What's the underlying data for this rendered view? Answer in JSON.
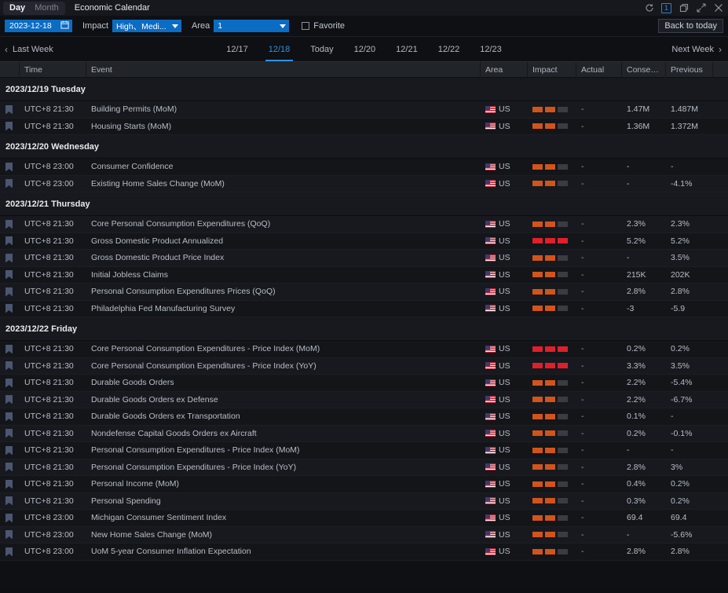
{
  "titlebar": {
    "modes": [
      {
        "label": "Day",
        "active": true
      },
      {
        "label": "Month",
        "active": false
      }
    ],
    "app_title": "Economic Calendar",
    "window_controls": [
      {
        "name": "refresh-icon",
        "label": "↻"
      },
      {
        "name": "window-count-badge",
        "label": "1"
      },
      {
        "name": "restore-icon",
        "label": "❐"
      },
      {
        "name": "expand-icon",
        "label": "⤢"
      },
      {
        "name": "close-icon",
        "label": "✕"
      }
    ]
  },
  "filters": {
    "date_value": "2023-12-18",
    "calendar_icon": "calendar-icon",
    "impact_label": "Impact",
    "impact_value": "High、Medi...",
    "area_label": "Area",
    "area_value": "1",
    "favorite_label": "Favorite",
    "favorite_checked": false,
    "back_to_today": "Back to today"
  },
  "datenav": {
    "prev_label": "Last Week",
    "next_label": "Next Week",
    "tabs": [
      {
        "label": "12/17",
        "active": false
      },
      {
        "label": "12/18",
        "active": true
      },
      {
        "label": "Today",
        "active": false
      },
      {
        "label": "12/20",
        "active": false
      },
      {
        "label": "12/21",
        "active": false
      },
      {
        "label": "12/22",
        "active": false
      },
      {
        "label": "12/23",
        "active": false
      }
    ]
  },
  "table": {
    "headers": {
      "bookmark": "",
      "time": "Time",
      "event": "Event",
      "area": "Area",
      "impact": "Impact",
      "actual": "Actual",
      "consensus": "Consensus",
      "previous": "Previous"
    },
    "groups": [
      {
        "date_label": "2023/12/19 Tuesday",
        "rows": [
          {
            "time": "UTC+8 21:30",
            "event": "Building Permits (MoM)",
            "area": "US",
            "impact": 2,
            "actual": "-",
            "consensus": "1.47M",
            "previous": "1.487M"
          },
          {
            "time": "UTC+8 21:30",
            "event": "Housing Starts (MoM)",
            "area": "US",
            "impact": 2,
            "actual": "-",
            "consensus": "1.36M",
            "previous": "1.372M"
          }
        ]
      },
      {
        "date_label": "2023/12/20 Wednesday",
        "rows": [
          {
            "time": "UTC+8 23:00",
            "event": "Consumer Confidence",
            "area": "US",
            "impact": 2,
            "actual": "-",
            "consensus": "-",
            "previous": "-"
          },
          {
            "time": "UTC+8 23:00",
            "event": "Existing Home Sales Change (MoM)",
            "area": "US",
            "impact": 2,
            "actual": "-",
            "consensus": "-",
            "previous": "-4.1%"
          }
        ]
      },
      {
        "date_label": "2023/12/21 Thursday",
        "rows": [
          {
            "time": "UTC+8 21:30",
            "event": "Core Personal Consumption Expenditures (QoQ)",
            "area": "US",
            "impact": 2,
            "actual": "-",
            "consensus": "2.3%",
            "previous": "2.3%"
          },
          {
            "time": "UTC+8 21:30",
            "event": "Gross Domestic Product Annualized",
            "area": "US",
            "impact": 3,
            "actual": "-",
            "consensus": "5.2%",
            "previous": "5.2%"
          },
          {
            "time": "UTC+8 21:30",
            "event": "Gross Domestic Product Price Index",
            "area": "US",
            "impact": 2,
            "actual": "-",
            "consensus": "-",
            "previous": "3.5%"
          },
          {
            "time": "UTC+8 21:30",
            "event": "Initial Jobless Claims",
            "area": "US",
            "impact": 2,
            "actual": "-",
            "consensus": "215K",
            "previous": "202K"
          },
          {
            "time": "UTC+8 21:30",
            "event": "Personal Consumption Expenditures Prices (QoQ)",
            "area": "US",
            "impact": 2,
            "actual": "-",
            "consensus": "2.8%",
            "previous": "2.8%"
          },
          {
            "time": "UTC+8 21:30",
            "event": "Philadelphia Fed Manufacturing Survey",
            "area": "US",
            "impact": 2,
            "actual": "-",
            "consensus": "-3",
            "previous": "-5.9"
          }
        ]
      },
      {
        "date_label": "2023/12/22 Friday",
        "rows": [
          {
            "time": "UTC+8 21:30",
            "event": "Core Personal Consumption Expenditures - Price Index (MoM)",
            "area": "US",
            "impact": 3,
            "actual": "-",
            "consensus": "0.2%",
            "previous": "0.2%"
          },
          {
            "time": "UTC+8 21:30",
            "event": "Core Personal Consumption Expenditures - Price Index (YoY)",
            "area": "US",
            "impact": 3,
            "actual": "-",
            "consensus": "3.3%",
            "previous": "3.5%"
          },
          {
            "time": "UTC+8 21:30",
            "event": "Durable Goods Orders",
            "area": "US",
            "impact": 2,
            "actual": "-",
            "consensus": "2.2%",
            "previous": "-5.4%"
          },
          {
            "time": "UTC+8 21:30",
            "event": "Durable Goods Orders ex Defense",
            "area": "US",
            "impact": 2,
            "actual": "-",
            "consensus": "2.2%",
            "previous": "-6.7%"
          },
          {
            "time": "UTC+8 21:30",
            "event": "Durable Goods Orders ex Transportation",
            "area": "US",
            "impact": 2,
            "actual": "-",
            "consensus": "0.1%",
            "previous": "-"
          },
          {
            "time": "UTC+8 21:30",
            "event": "Nondefense Capital Goods Orders ex Aircraft",
            "area": "US",
            "impact": 2,
            "actual": "-",
            "consensus": "0.2%",
            "previous": "-0.1%"
          },
          {
            "time": "UTC+8 21:30",
            "event": "Personal Consumption Expenditures - Price Index (MoM)",
            "area": "US",
            "impact": 2,
            "actual": "-",
            "consensus": "-",
            "previous": "-"
          },
          {
            "time": "UTC+8 21:30",
            "event": "Personal Consumption Expenditures - Price Index (YoY)",
            "area": "US",
            "impact": 2,
            "actual": "-",
            "consensus": "2.8%",
            "previous": "3%"
          },
          {
            "time": "UTC+8 21:30",
            "event": "Personal Income (MoM)",
            "area": "US",
            "impact": 2,
            "actual": "-",
            "consensus": "0.4%",
            "previous": "0.2%"
          },
          {
            "time": "UTC+8 21:30",
            "event": "Personal Spending",
            "area": "US",
            "impact": 2,
            "actual": "-",
            "consensus": "0.3%",
            "previous": "0.2%"
          },
          {
            "time": "UTC+8 23:00",
            "event": "Michigan Consumer Sentiment Index",
            "area": "US",
            "impact": 2,
            "actual": "-",
            "consensus": "69.4",
            "previous": "69.4"
          },
          {
            "time": "UTC+8 23:00",
            "event": "New Home Sales Change (MoM)",
            "area": "US",
            "impact": 2,
            "actual": "-",
            "consensus": "-",
            "previous": "-5.6%"
          },
          {
            "time": "UTC+8 23:00",
            "event": "UoM 5-year Consumer Inflation Expectation",
            "area": "US",
            "impact": 2,
            "actual": "-",
            "consensus": "2.8%",
            "previous": "2.8%"
          }
        ]
      }
    ]
  },
  "colors": {
    "accent_blue": "#0b6cc4",
    "active_tab_blue": "#2f8fe0",
    "impact_medium": "#d2541a",
    "impact_high": "#e01f2b",
    "impact_off": "#3a3c41",
    "background": "#0e1014"
  }
}
